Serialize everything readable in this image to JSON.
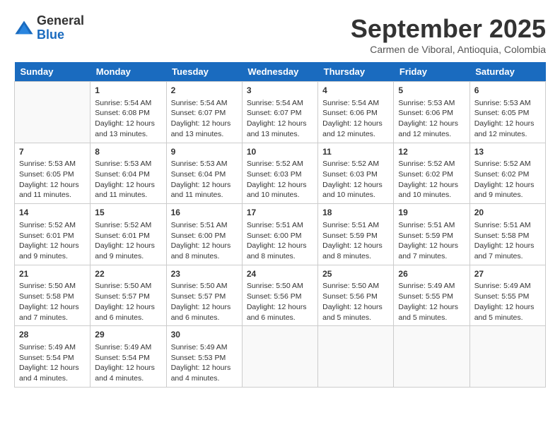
{
  "header": {
    "logo": {
      "general": "General",
      "blue": "Blue"
    },
    "title": "September 2025",
    "location": "Carmen de Viboral, Antioquia, Colombia"
  },
  "calendar": {
    "days_of_week": [
      "Sunday",
      "Monday",
      "Tuesday",
      "Wednesday",
      "Thursday",
      "Friday",
      "Saturday"
    ],
    "weeks": [
      [
        {
          "day": null,
          "info": null
        },
        {
          "day": "1",
          "info": "Sunrise: 5:54 AM\nSunset: 6:08 PM\nDaylight: 12 hours\nand 13 minutes."
        },
        {
          "day": "2",
          "info": "Sunrise: 5:54 AM\nSunset: 6:07 PM\nDaylight: 12 hours\nand 13 minutes."
        },
        {
          "day": "3",
          "info": "Sunrise: 5:54 AM\nSunset: 6:07 PM\nDaylight: 12 hours\nand 13 minutes."
        },
        {
          "day": "4",
          "info": "Sunrise: 5:54 AM\nSunset: 6:06 PM\nDaylight: 12 hours\nand 12 minutes."
        },
        {
          "day": "5",
          "info": "Sunrise: 5:53 AM\nSunset: 6:06 PM\nDaylight: 12 hours\nand 12 minutes."
        },
        {
          "day": "6",
          "info": "Sunrise: 5:53 AM\nSunset: 6:05 PM\nDaylight: 12 hours\nand 12 minutes."
        }
      ],
      [
        {
          "day": "7",
          "info": "Sunrise: 5:53 AM\nSunset: 6:05 PM\nDaylight: 12 hours\nand 11 minutes."
        },
        {
          "day": "8",
          "info": "Sunrise: 5:53 AM\nSunset: 6:04 PM\nDaylight: 12 hours\nand 11 minutes."
        },
        {
          "day": "9",
          "info": "Sunrise: 5:53 AM\nSunset: 6:04 PM\nDaylight: 12 hours\nand 11 minutes."
        },
        {
          "day": "10",
          "info": "Sunrise: 5:52 AM\nSunset: 6:03 PM\nDaylight: 12 hours\nand 10 minutes."
        },
        {
          "day": "11",
          "info": "Sunrise: 5:52 AM\nSunset: 6:03 PM\nDaylight: 12 hours\nand 10 minutes."
        },
        {
          "day": "12",
          "info": "Sunrise: 5:52 AM\nSunset: 6:02 PM\nDaylight: 12 hours\nand 10 minutes."
        },
        {
          "day": "13",
          "info": "Sunrise: 5:52 AM\nSunset: 6:02 PM\nDaylight: 12 hours\nand 9 minutes."
        }
      ],
      [
        {
          "day": "14",
          "info": "Sunrise: 5:52 AM\nSunset: 6:01 PM\nDaylight: 12 hours\nand 9 minutes."
        },
        {
          "day": "15",
          "info": "Sunrise: 5:52 AM\nSunset: 6:01 PM\nDaylight: 12 hours\nand 9 minutes."
        },
        {
          "day": "16",
          "info": "Sunrise: 5:51 AM\nSunset: 6:00 PM\nDaylight: 12 hours\nand 8 minutes."
        },
        {
          "day": "17",
          "info": "Sunrise: 5:51 AM\nSunset: 6:00 PM\nDaylight: 12 hours\nand 8 minutes."
        },
        {
          "day": "18",
          "info": "Sunrise: 5:51 AM\nSunset: 5:59 PM\nDaylight: 12 hours\nand 8 minutes."
        },
        {
          "day": "19",
          "info": "Sunrise: 5:51 AM\nSunset: 5:59 PM\nDaylight: 12 hours\nand 7 minutes."
        },
        {
          "day": "20",
          "info": "Sunrise: 5:51 AM\nSunset: 5:58 PM\nDaylight: 12 hours\nand 7 minutes."
        }
      ],
      [
        {
          "day": "21",
          "info": "Sunrise: 5:50 AM\nSunset: 5:58 PM\nDaylight: 12 hours\nand 7 minutes."
        },
        {
          "day": "22",
          "info": "Sunrise: 5:50 AM\nSunset: 5:57 PM\nDaylight: 12 hours\nand 6 minutes."
        },
        {
          "day": "23",
          "info": "Sunrise: 5:50 AM\nSunset: 5:57 PM\nDaylight: 12 hours\nand 6 minutes."
        },
        {
          "day": "24",
          "info": "Sunrise: 5:50 AM\nSunset: 5:56 PM\nDaylight: 12 hours\nand 6 minutes."
        },
        {
          "day": "25",
          "info": "Sunrise: 5:50 AM\nSunset: 5:56 PM\nDaylight: 12 hours\nand 5 minutes."
        },
        {
          "day": "26",
          "info": "Sunrise: 5:49 AM\nSunset: 5:55 PM\nDaylight: 12 hours\nand 5 minutes."
        },
        {
          "day": "27",
          "info": "Sunrise: 5:49 AM\nSunset: 5:55 PM\nDaylight: 12 hours\nand 5 minutes."
        }
      ],
      [
        {
          "day": "28",
          "info": "Sunrise: 5:49 AM\nSunset: 5:54 PM\nDaylight: 12 hours\nand 4 minutes."
        },
        {
          "day": "29",
          "info": "Sunrise: 5:49 AM\nSunset: 5:54 PM\nDaylight: 12 hours\nand 4 minutes."
        },
        {
          "day": "30",
          "info": "Sunrise: 5:49 AM\nSunset: 5:53 PM\nDaylight: 12 hours\nand 4 minutes."
        },
        {
          "day": null,
          "info": null
        },
        {
          "day": null,
          "info": null
        },
        {
          "day": null,
          "info": null
        },
        {
          "day": null,
          "info": null
        }
      ]
    ]
  }
}
